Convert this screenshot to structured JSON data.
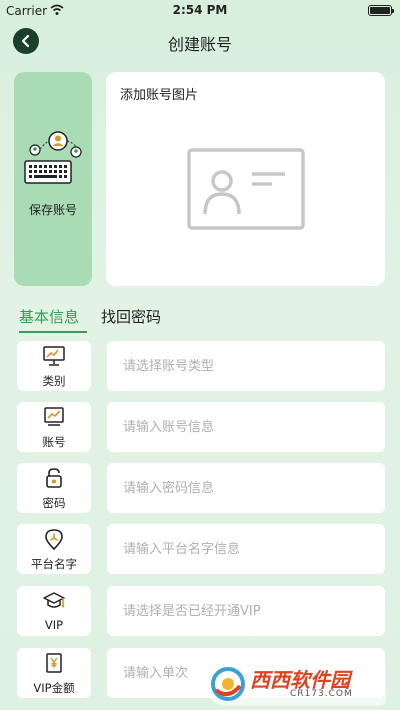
{
  "status_bar": {
    "carrier": "Carrier",
    "time": "2:54 PM"
  },
  "header": {
    "title": "创建账号"
  },
  "save_card": {
    "label": "保存账号"
  },
  "photo_card": {
    "title": "添加账号图片"
  },
  "tabs": [
    {
      "label": "基本信息",
      "active": true
    },
    {
      "label": "找回密码",
      "active": false
    }
  ],
  "form_rows": [
    {
      "label": "类别",
      "placeholder": "请选择账号类型",
      "icon": "monitor-chart-icon"
    },
    {
      "label": "账号",
      "placeholder": "请输入账号信息",
      "icon": "chart-frame-icon"
    },
    {
      "label": "密码",
      "placeholder": "请输入密码信息",
      "icon": "lock-icon"
    },
    {
      "label": "平台名字",
      "placeholder": "请输入平台名字信息",
      "icon": "location-pin-icon"
    },
    {
      "label": "VIP",
      "placeholder": "请选择是否已经开通VIP",
      "icon": "graduation-cap-icon"
    },
    {
      "label": "VIP金额",
      "placeholder": "请输入单次",
      "icon": "yen-note-icon"
    }
  ],
  "watermark": {
    "brand": "西西软件园",
    "url": "CR173.COM"
  },
  "colors": {
    "accent": "#3a9a58",
    "save_card": "#a9dcb4",
    "back_button": "#1a3f2b"
  }
}
